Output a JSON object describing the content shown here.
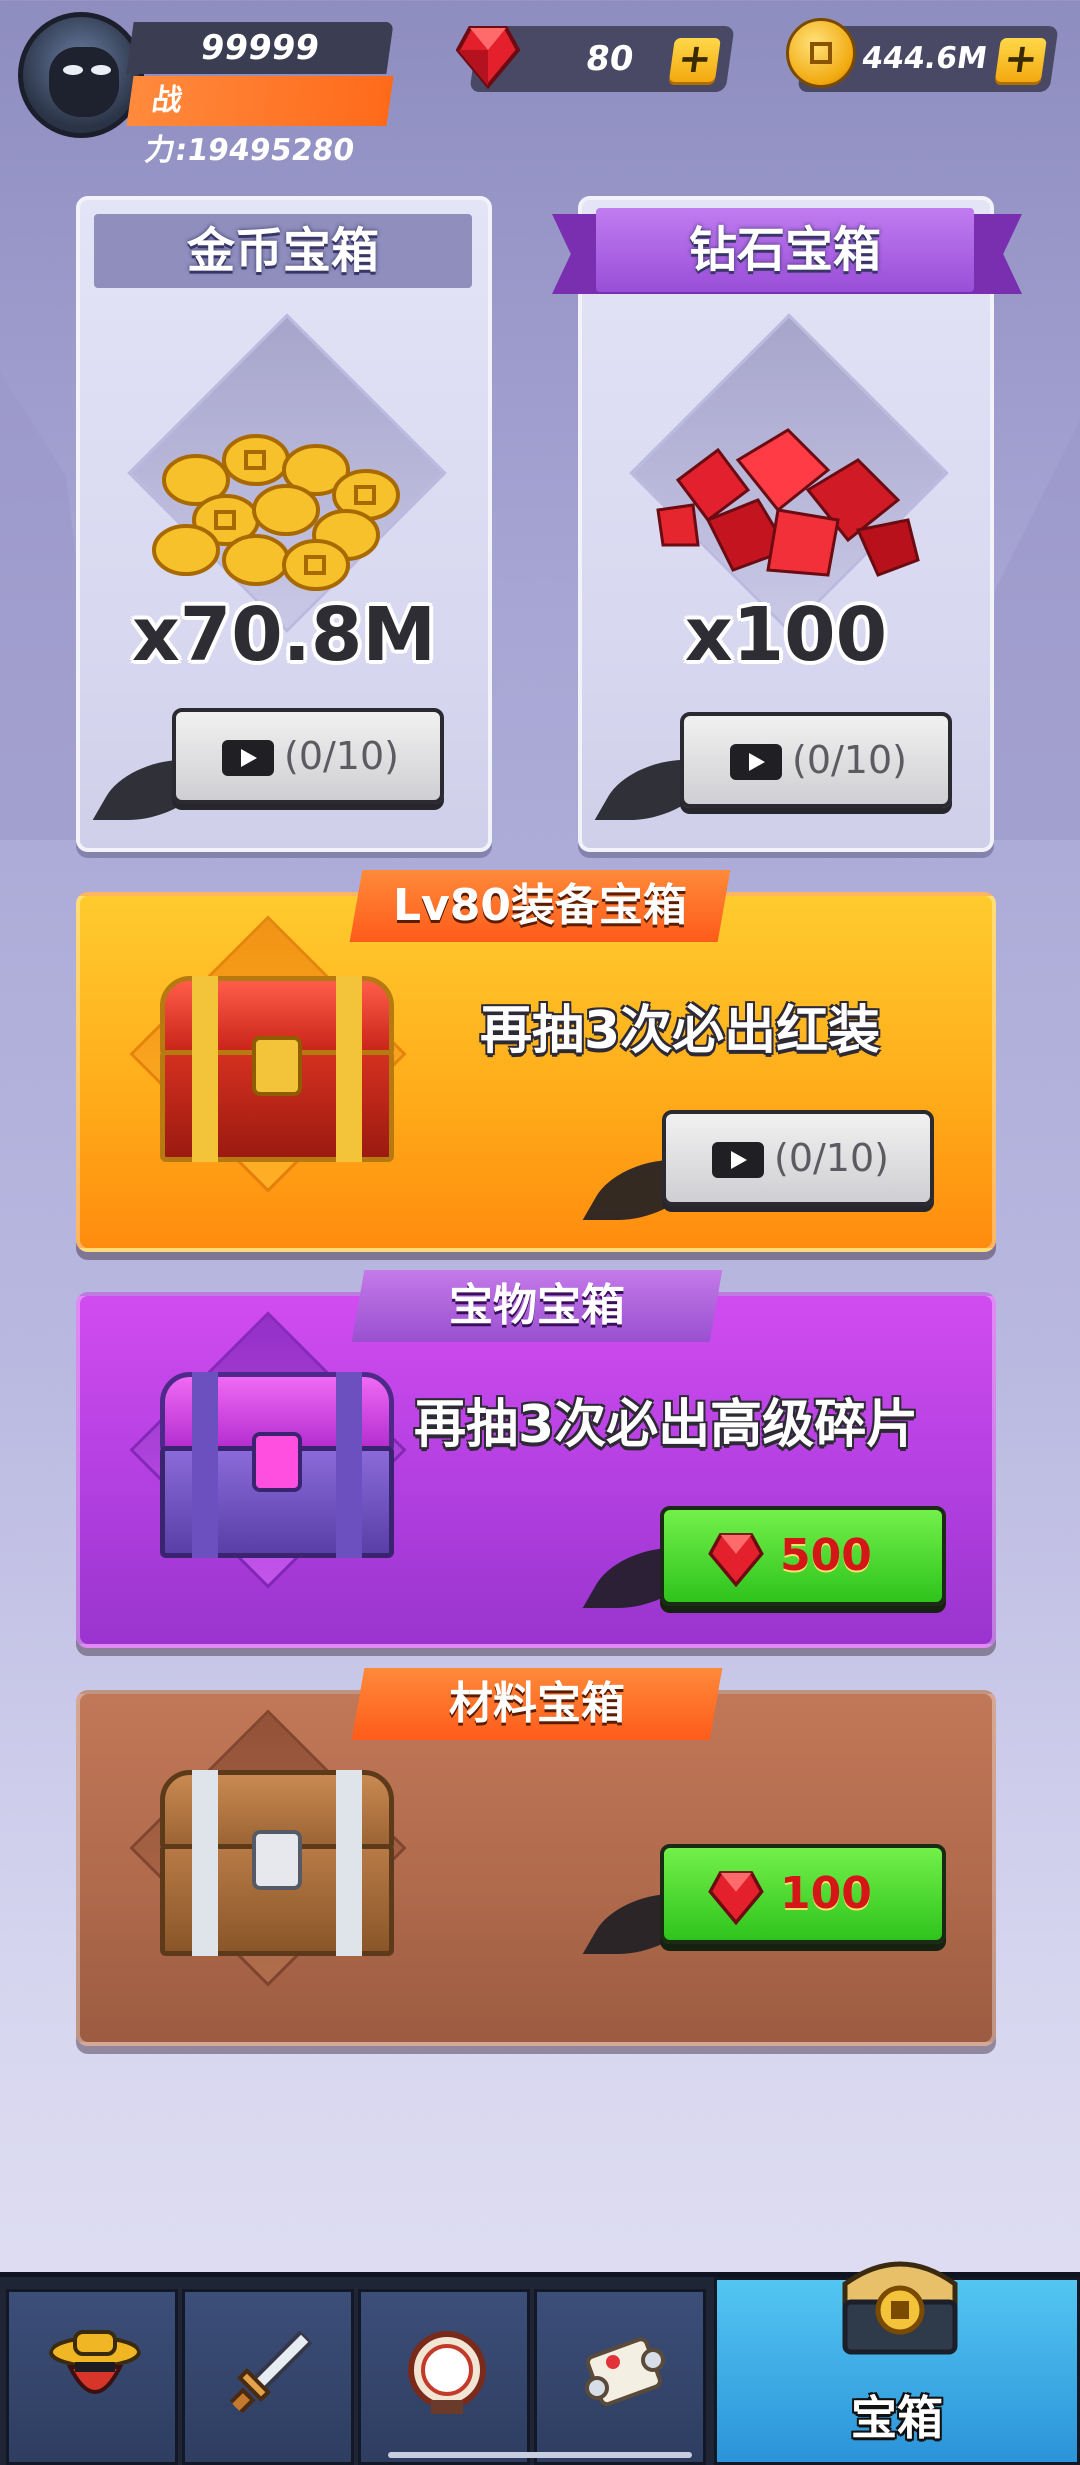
{
  "player": {
    "level_value": "99999",
    "power_text": "战力:19495280"
  },
  "currency": {
    "gems": "80",
    "coins": "444.6M"
  },
  "cards": [
    {
      "title": "金币宝箱",
      "amount": "x70.8M",
      "ad_count": "(0/10)"
    },
    {
      "title": "钻石宝箱",
      "amount": "x100",
      "ad_count": "(0/10)"
    }
  ],
  "banners": {
    "equipment": {
      "ribbon": "Lv80装备宝箱",
      "subtitle": "再抽3次必出红装",
      "ad_count": "(0/10)"
    },
    "treasure": {
      "ribbon": "宝物宝箱",
      "subtitle": "再抽3次必出高级碎片",
      "price": "500"
    },
    "material": {
      "ribbon": "材料宝箱",
      "price": "100"
    }
  },
  "nav": {
    "items": [
      {
        "icon": "hero-icon"
      },
      {
        "icon": "sword-icon"
      },
      {
        "icon": "drum-icon"
      },
      {
        "icon": "scroll-icon"
      },
      {
        "icon": "treasure-chest-icon",
        "label": "宝箱"
      }
    ]
  },
  "colors": {
    "gold_banner": "#ffb21c",
    "purple_banner": "#b23fe0",
    "brown_banner": "#b06a4c",
    "green_button": "#3fd326",
    "price_red": "#d41616"
  }
}
